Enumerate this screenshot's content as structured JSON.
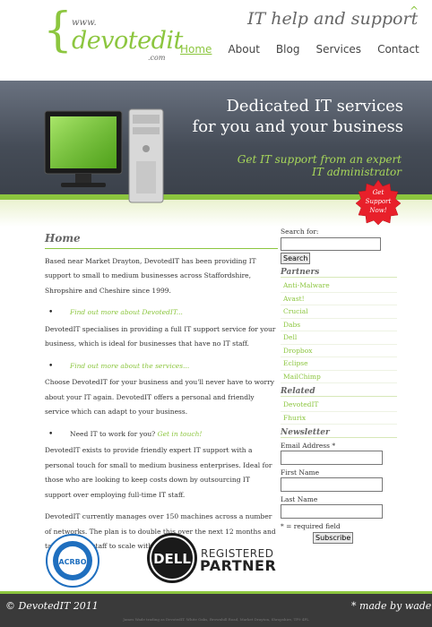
{
  "header": {
    "logo_www": "www.",
    "logo_brace": "{",
    "logo_name": "devotedit",
    "logo_com": ".com",
    "tagline": "IT help and support",
    "top_arrow": "^",
    "nav": [
      "Home",
      "About",
      "Blog",
      "Services",
      "Contact"
    ],
    "active_nav": "Home"
  },
  "banner": {
    "line1": "Dedicated IT services",
    "line2": "for you and your business",
    "line3": "Get IT support from an expert",
    "line4": "IT administrator",
    "badge_lines": [
      "Get",
      "Support",
      "Now!"
    ]
  },
  "main": {
    "heading": "Home",
    "intro": "Based near Market Drayton, DevotedIT has been providing IT support to small to medium businesses across Staffordshire, Shropshire and Cheshire since 1999.",
    "bullet1": "Find out more about DevotedIT...",
    "para1": "DevotedIT specialises in providing a full IT support service for your business, which is ideal for businesses that have no IT staff.",
    "bullet2": "Find out more about the services...",
    "para2": "Choose DevotedIT for your business and you'll never have to worry about your IT again. DevotedIT offers a personal and friendly service which can adapt to your business.",
    "bullet3_text": "Need IT to work for you?",
    "bullet3_link": "Get in touch!",
    "para3": "DevotedIT exists to provide friendly expert IT support with a personal touch for small to medium business enterprises. Ideal for those who are looking to keep costs down by outsourcing IT support over employing full-time IT staff.",
    "para4": "DevotedIT currently manages over 150 machines across a number of networks. The plan is to double this over the next 12 months and take on extra staff to scale with expansion."
  },
  "sidebar": {
    "search_label": "Search for:",
    "search_value": "",
    "search_button": "Search",
    "partners_heading": "Partners",
    "partners": [
      "Anti-Malware",
      "Avast!",
      "Crucial",
      "Dabs",
      "Dell",
      "Dropbox",
      "Eclipse",
      "MailChimp"
    ],
    "related_heading": "Related",
    "related": [
      "DevotedIT",
      "Fhurix"
    ],
    "newsletter_heading": "Newsletter",
    "email_label": "Email Address *",
    "firstname_label": "First Name",
    "lastname_label": "Last Name",
    "required_note": "* = required field",
    "subscribe_button": "Subscribe"
  },
  "logos": {
    "acrbo_text": "ACRBO",
    "dell_text": "DELL",
    "registered": "REGISTERED",
    "partner": "PARTNER"
  },
  "footer": {
    "copyright": "© DevotedIT 2011",
    "madeby": "* made by wade",
    "fineprint": "James Wade trading as DevotedIT. White Oaks, Brownhill Road, Market Drayton, Shropshire, TF9 4PL"
  },
  "colors": {
    "accent": "#8cc63f",
    "footer": "#3a3a3a",
    "banner": "#454c57",
    "badge": "#e8202a"
  }
}
